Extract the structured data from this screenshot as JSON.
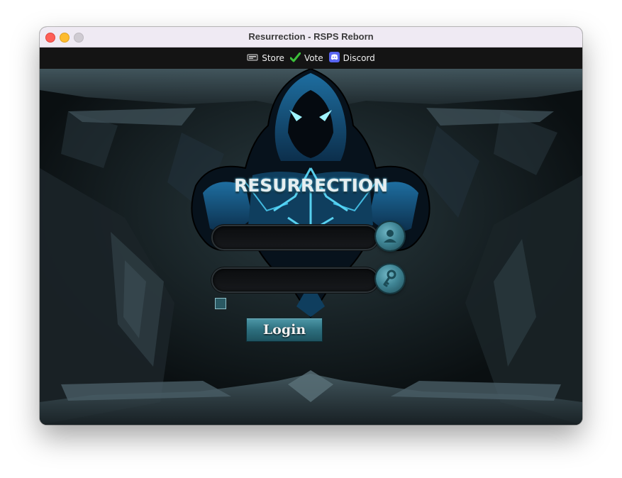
{
  "window": {
    "title": "Resurrection - RSPS Reborn"
  },
  "toolbar": {
    "links": [
      {
        "label": "Store",
        "icon": "store-icon"
      },
      {
        "label": "Vote",
        "icon": "checkmark-icon"
      },
      {
        "label": "Discord",
        "icon": "discord-icon"
      }
    ]
  },
  "login": {
    "logo_text": "RESURRECTION",
    "username_value": "",
    "password_value": "",
    "remember_checked": false,
    "button_label": "Login"
  },
  "colors": {
    "accent": "#3f8494",
    "toolbar_bg": "#141414",
    "titlebar_bg": "#efeaf3"
  }
}
